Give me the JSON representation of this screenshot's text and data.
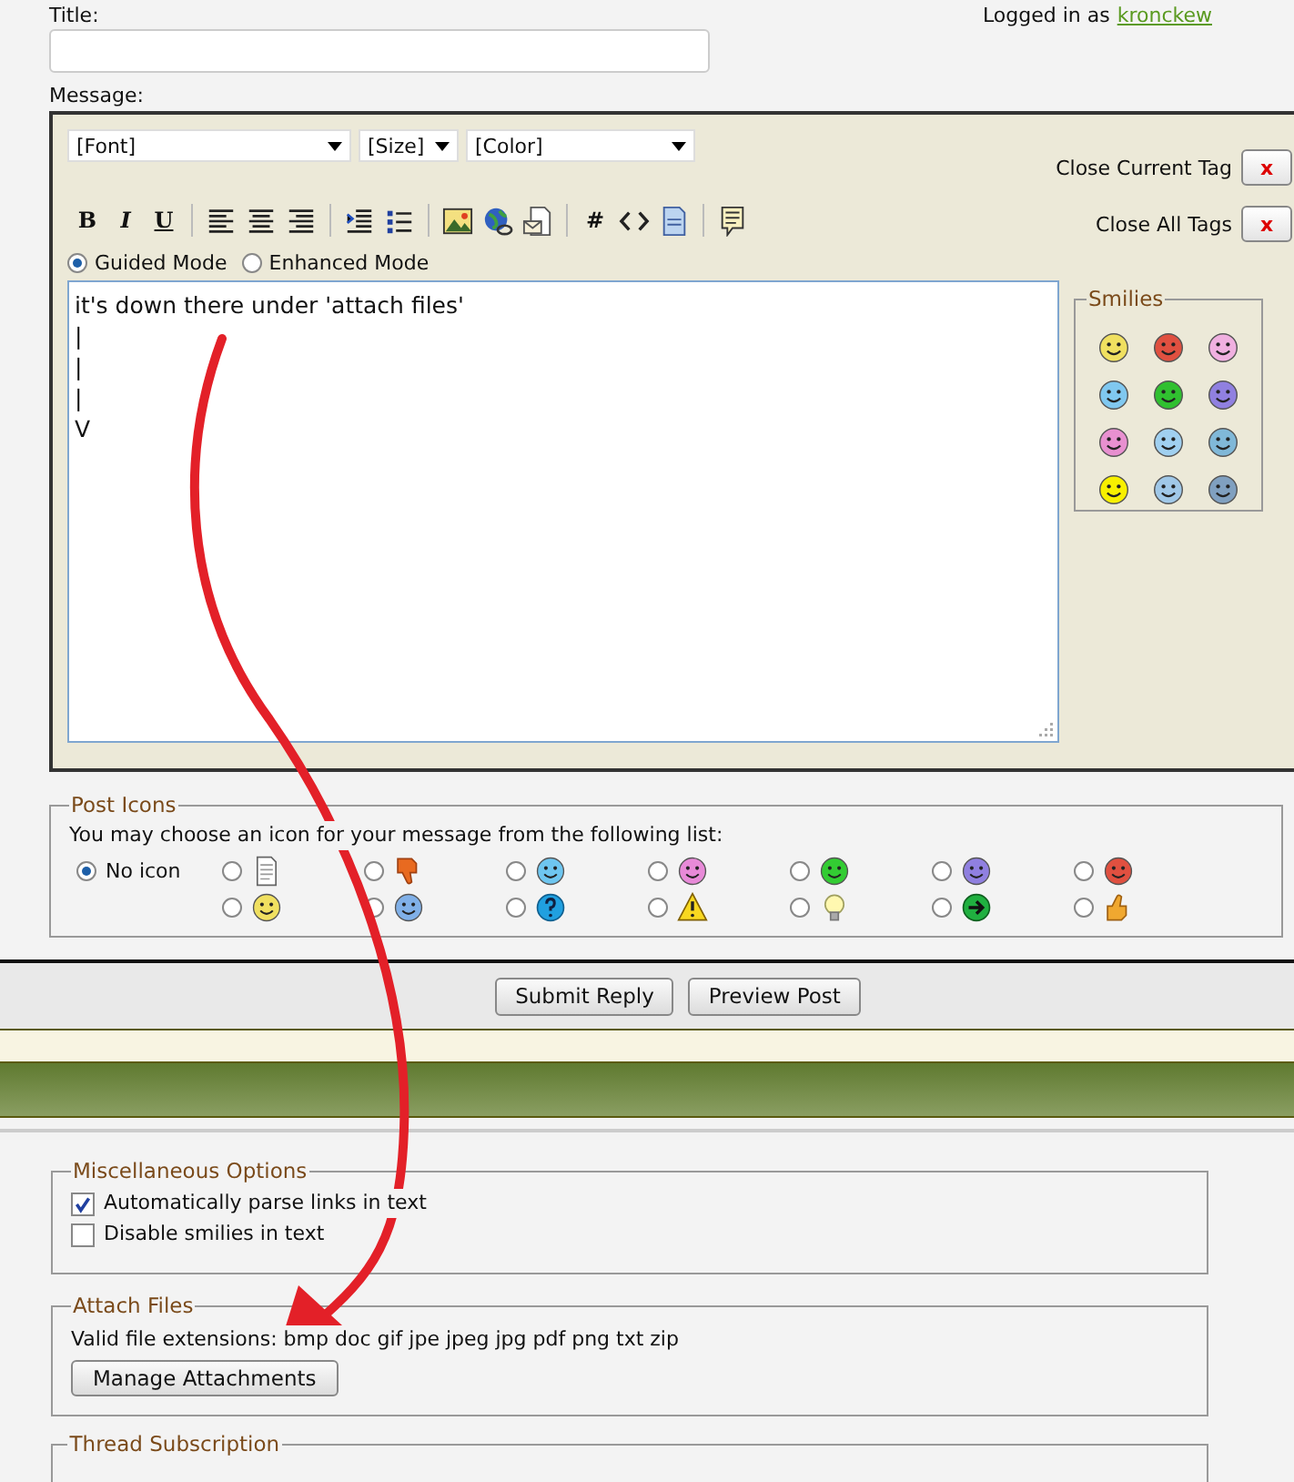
{
  "header": {
    "title_label": "Title:",
    "logged_in": "Logged in as",
    "username": "kronckew"
  },
  "message": {
    "label": "Message:",
    "selects": [
      {
        "value": "[Font]"
      },
      {
        "value": "[Size]"
      },
      {
        "value": "[Color]"
      }
    ],
    "close_buttons": [
      {
        "label": "Close Current Tag",
        "button": "x"
      },
      {
        "label": "Close All Tags",
        "button": "x"
      }
    ],
    "toolbar": [
      {
        "kind": "bold",
        "label": "B"
      },
      {
        "kind": "italic",
        "label": "I"
      },
      {
        "kind": "underline",
        "label": "U"
      },
      {
        "kind": "separator"
      },
      {
        "kind": "align-left"
      },
      {
        "kind": "align-center"
      },
      {
        "kind": "align-right"
      },
      {
        "kind": "separator"
      },
      {
        "kind": "indent"
      },
      {
        "kind": "list"
      },
      {
        "kind": "separator"
      },
      {
        "kind": "image"
      },
      {
        "kind": "globe"
      },
      {
        "kind": "email"
      },
      {
        "kind": "separator"
      },
      {
        "kind": "hash",
        "label": "#"
      },
      {
        "kind": "code"
      },
      {
        "kind": "document"
      },
      {
        "kind": "separator"
      },
      {
        "kind": "quote"
      }
    ],
    "modes": [
      {
        "label": "Guided Mode",
        "selected": true
      },
      {
        "label": "Enhanced Mode",
        "selected": false
      }
    ],
    "text_lines": [
      "it's down there under 'attach files'",
      "|",
      "|",
      "|",
      "V"
    ],
    "smilies": {
      "legend": "Smilies",
      "items": [
        {
          "color": "#f0e060"
        },
        {
          "color": "#e05040"
        },
        {
          "color": "#f0b0e0"
        },
        {
          "color": "#80c8f0"
        },
        {
          "color": "#30c030"
        },
        {
          "color": "#9080e0"
        },
        {
          "color": "#e890d0"
        },
        {
          "color": "#a0d0f0"
        },
        {
          "color": "#80b8d8"
        },
        {
          "color": "#f8f000"
        },
        {
          "color": "#a0c8e8"
        },
        {
          "color": "#80a0c0"
        }
      ]
    }
  },
  "post_icons": {
    "legend": "Post Icons",
    "prompt": "You may choose an icon for your message from the following list:",
    "options": [
      {
        "kind": "none",
        "label": "No icon",
        "selected": true
      },
      {
        "kind": "document",
        "selected": false
      },
      {
        "kind": "thumbs-down",
        "selected": false
      },
      {
        "kind": "smiley",
        "color": "#6ec6f0",
        "selected": false
      },
      {
        "kind": "smiley",
        "color": "#e88ad8",
        "selected": false
      },
      {
        "kind": "smiley",
        "color": "#33cc33",
        "selected": false
      },
      {
        "kind": "smiley",
        "color": "#9080e0",
        "selected": false
      },
      {
        "kind": "smiley",
        "color": "#e05040",
        "selected": false
      },
      {
        "kind": "smiley",
        "color": "#f0e060",
        "selected": false
      },
      {
        "kind": "smiley",
        "color": "#80b0e8",
        "selected": false
      },
      {
        "kind": "question",
        "selected": false
      },
      {
        "kind": "warning",
        "selected": false
      },
      {
        "kind": "bulb",
        "selected": false
      },
      {
        "kind": "arrow",
        "selected": false
      },
      {
        "kind": "thumbs-up",
        "selected": false
      }
    ]
  },
  "buttons": [
    "Submit Reply",
    "Preview Post"
  ],
  "misc_options": {
    "legend": "Miscellaneous Options",
    "options": [
      {
        "label": "Automatically parse links in text",
        "checked": true
      },
      {
        "label": "Disable smilies in text",
        "checked": false
      }
    ]
  },
  "attach_files": {
    "legend": "Attach Files",
    "extensions": "Valid file extensions: bmp doc gif jpe jpeg jpg pdf png txt zip",
    "button": "Manage Attachments"
  },
  "thread_subscription": {
    "legend": "Thread Subscription"
  }
}
